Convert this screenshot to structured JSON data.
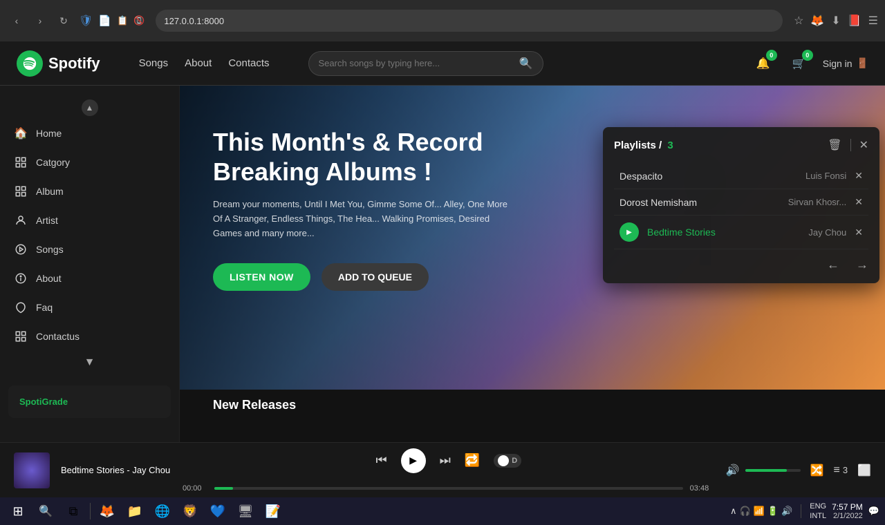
{
  "browser": {
    "url": "127.0.0.1:8000",
    "nav": {
      "back": "‹",
      "forward": "›",
      "refresh": "↻"
    }
  },
  "topnav": {
    "logo_text": "Spotify",
    "links": [
      "Songs",
      "About",
      "Contacts"
    ],
    "search_placeholder": "Search songs by typing here...",
    "badge_notifications": "0",
    "badge_cart": "0",
    "sign_in": "Sign in"
  },
  "sidebar": {
    "items": [
      {
        "label": "Home",
        "icon": "🏠"
      },
      {
        "label": "Catgory",
        "icon": "⊞"
      },
      {
        "label": "Album",
        "icon": "⊞"
      },
      {
        "label": "Artist",
        "icon": "👤"
      },
      {
        "label": "Songs",
        "icon": "▷"
      },
      {
        "label": "About",
        "icon": "◉"
      },
      {
        "label": "Faq",
        "icon": "🛡"
      },
      {
        "label": "Contactus",
        "icon": "⊞"
      }
    ],
    "spotigrade": "SpotiGrade"
  },
  "hero": {
    "title": "This Month's & Record Breaking Albums !",
    "description": "Dream your moments, Until I Met You, Gimme Some Of... Alley, One More Of A Stranger, Endless Things, The Hea... Walking Promises, Desired Games and many more...",
    "btn_listen": "LISTEN NOW",
    "btn_queue": "ADD TO QUEUE"
  },
  "playlist": {
    "title": "Playlists /",
    "count": "3",
    "songs": [
      {
        "name": "Despacito",
        "artist": "Luis Fonsi",
        "playing": false
      },
      {
        "name": "Dorost Nemisham",
        "artist": "Sirvan Khosr...",
        "playing": false
      },
      {
        "name": "Bedtime Stories",
        "artist": "Jay Chou",
        "playing": true
      }
    ]
  },
  "now_playing": {
    "song": "Bedtime Stories - Jay Chou",
    "artist": "",
    "time_current": "00:00",
    "time_total": "03:48",
    "progress_pct": 4,
    "volume_pct": 75,
    "queue_count": "3"
  },
  "taskbar": {
    "time": "7:57 PM",
    "date": "2/1/2022",
    "lang": "ENG\nINTL"
  }
}
